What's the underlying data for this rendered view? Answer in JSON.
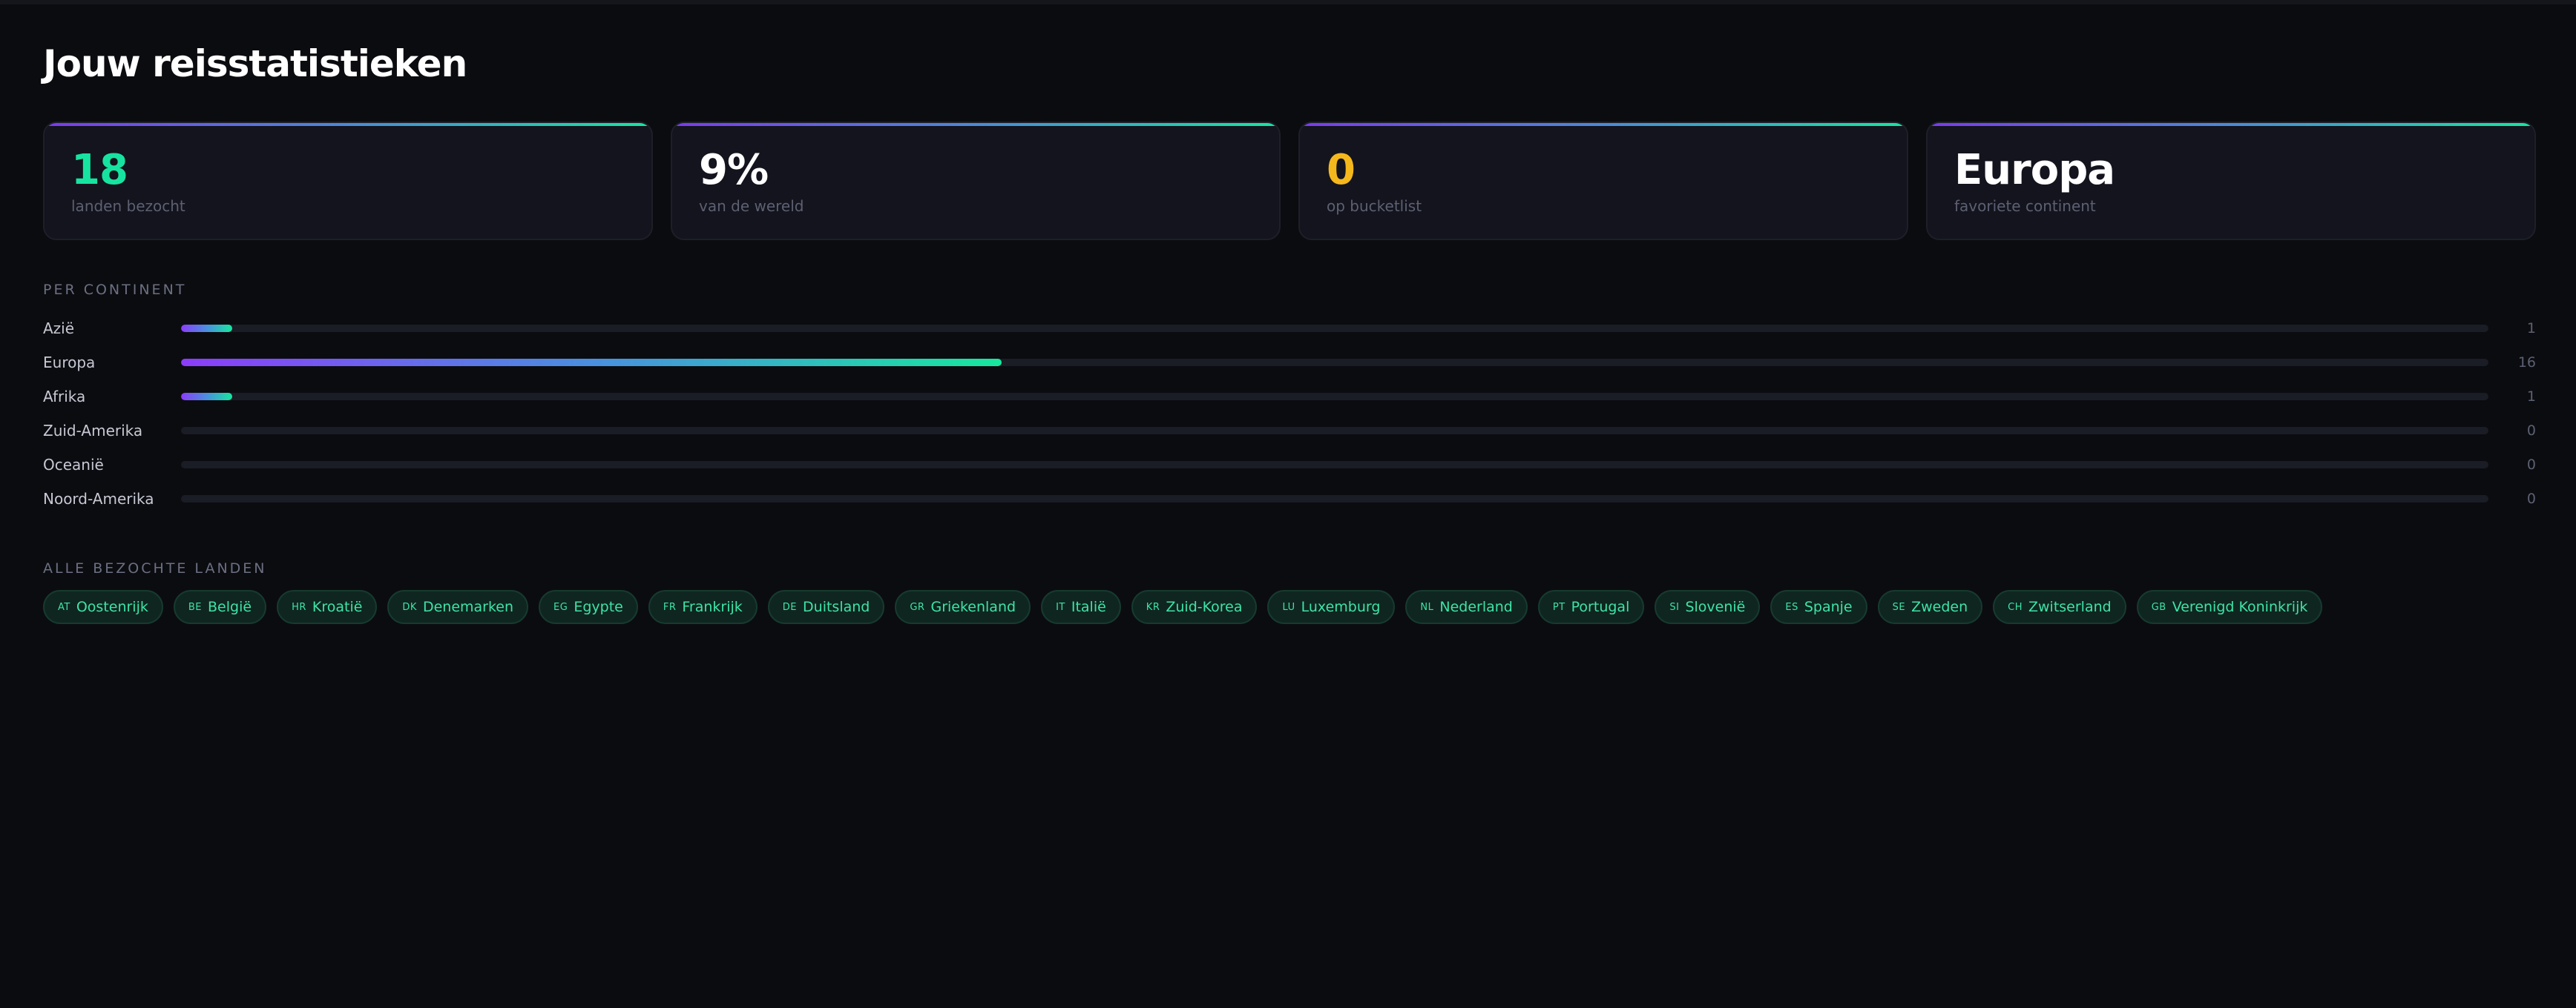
{
  "page": {
    "title": "Jouw reisstatistieken"
  },
  "stats": [
    {
      "value": "18",
      "label": "landen bezocht",
      "color": "#17e3a0"
    },
    {
      "value": "9%",
      "label": "van de wereld",
      "color": "#ffffff"
    },
    {
      "value": "0",
      "label": "op bucketlist",
      "color": "#f5b81c"
    },
    {
      "value": "Europa",
      "label": "favoriete continent",
      "color": "#ffffff"
    }
  ],
  "continents": {
    "section_title": "PER CONTINENT",
    "max": 45,
    "rows": [
      {
        "name": "Azië",
        "count": 1
      },
      {
        "name": "Europa",
        "count": 16
      },
      {
        "name": "Afrika",
        "count": 1
      },
      {
        "name": "Zuid-Amerika",
        "count": 0
      },
      {
        "name": "Oceanië",
        "count": 0
      },
      {
        "name": "Noord-Amerika",
        "count": 0
      }
    ]
  },
  "countries": {
    "section_title": "ALLE BEZOCHTE LANDEN",
    "items": [
      {
        "code": "AT",
        "name": "Oostenrijk"
      },
      {
        "code": "BE",
        "name": "België"
      },
      {
        "code": "HR",
        "name": "Kroatië"
      },
      {
        "code": "DK",
        "name": "Denemarken"
      },
      {
        "code": "EG",
        "name": "Egypte"
      },
      {
        "code": "FR",
        "name": "Frankrijk"
      },
      {
        "code": "DE",
        "name": "Duitsland"
      },
      {
        "code": "GR",
        "name": "Griekenland"
      },
      {
        "code": "IT",
        "name": "Italië"
      },
      {
        "code": "KR",
        "name": "Zuid-Korea"
      },
      {
        "code": "LU",
        "name": "Luxemburg"
      },
      {
        "code": "NL",
        "name": "Nederland"
      },
      {
        "code": "PT",
        "name": "Portugal"
      },
      {
        "code": "SI",
        "name": "Slovenië"
      },
      {
        "code": "ES",
        "name": "Spanje"
      },
      {
        "code": "SE",
        "name": "Zweden"
      },
      {
        "code": "CH",
        "name": "Zwitserland"
      },
      {
        "code": "GB",
        "name": "Verenigd Koninkrijk"
      }
    ]
  }
}
